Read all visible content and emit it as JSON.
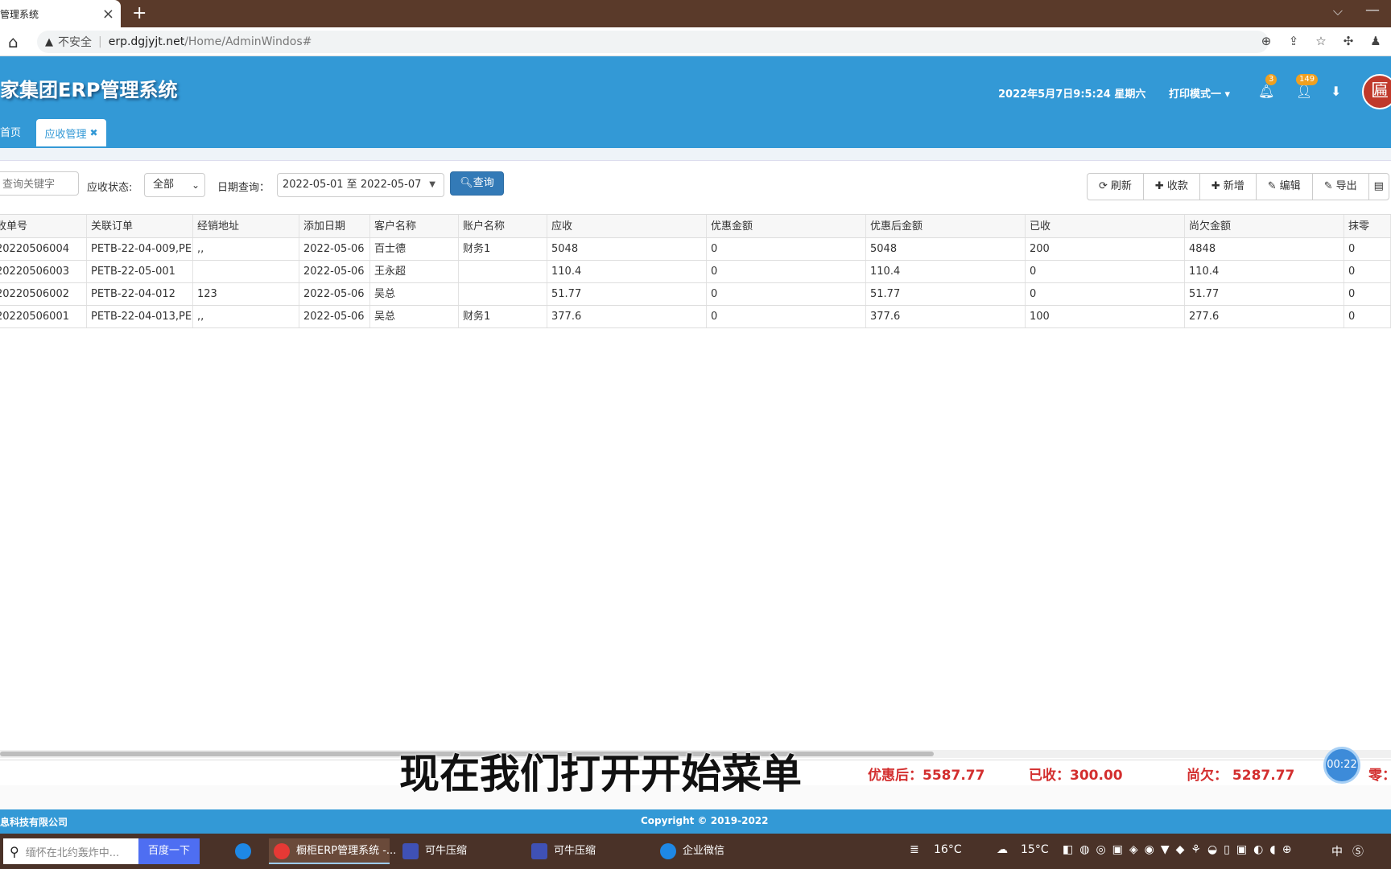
{
  "browser": {
    "tab_title": "管理系统",
    "insecure_label": "不安全",
    "url_host": "erp.dgjyjt.net",
    "url_path": "/Home/AdminWindos#"
  },
  "header": {
    "app_title": "家集团ERP管理系统",
    "datetime": "2022年5月7日9:5:24 星期六",
    "print_mode": "打印模式一",
    "notify_count": "3",
    "user_count": "149",
    "avatar_glyph": "匾"
  },
  "tabs": {
    "home": "首页",
    "active": "应收管理",
    "close": "✖"
  },
  "toolbar": {
    "search_placeholder": "查询关键字",
    "status_label": "应收状态:",
    "status_value": "全部",
    "date_label": "日期查询：",
    "date_range": "2022-05-01 至 2022-05-07",
    "query_label": "查询",
    "buttons": [
      {
        "icon": "refresh-icon",
        "label": "刷新"
      },
      {
        "icon": "plus-icon",
        "label": "收款"
      },
      {
        "icon": "plus-icon",
        "label": "新增"
      },
      {
        "icon": "edit-icon",
        "label": "编辑"
      },
      {
        "icon": "edit-icon",
        "label": "导出"
      }
    ]
  },
  "table": {
    "columns": [
      "收单号",
      "关联订单",
      "经销地址",
      "添加日期",
      "客户名称",
      "账户名称",
      "应收",
      "优惠金额",
      "优惠后金额",
      "已收",
      "尚欠金额",
      "抹零"
    ],
    "rows": [
      [
        "20220506004",
        "PETB-22-04-009,PE",
        ",,",
        "2022-05-06",
        "百士德",
        "财务1",
        "5048",
        "0",
        "5048",
        "200",
        "4848",
        "0"
      ],
      [
        "20220506003",
        "PETB-22-05-001",
        "",
        "2022-05-06",
        "王永超",
        "",
        "110.4",
        "0",
        "110.4",
        "0",
        "110.4",
        "0"
      ],
      [
        "20220506002",
        "PETB-22-04-012",
        "123",
        "2022-05-06",
        "吴总",
        "",
        "51.77",
        "0",
        "51.77",
        "0",
        "51.77",
        "0"
      ],
      [
        "20220506001",
        "PETB-22-04-013,PE",
        ",,",
        "2022-05-06",
        "吴总",
        "财务1",
        "377.6",
        "0",
        "377.6",
        "100",
        "277.6",
        "0"
      ]
    ]
  },
  "summary": {
    "after_discount": "优惠后：5587.77",
    "received": "已收：300.00",
    "owed": "尚欠：  5287.77",
    "wipe": "零："
  },
  "overlay": {
    "subtitle": "现在我们打开开始菜单",
    "timer": "00:22"
  },
  "footer": {
    "company": "息科技有限公司",
    "copyright": "Copyright © 2019-2022"
  },
  "taskbar": {
    "search_placeholder": "缅怀在北约轰炸中...",
    "baidu_label": "百度一下",
    "apps": [
      "橱柜ERP管理系统 -...",
      "可牛压缩",
      "可牛压缩",
      "企业微信"
    ],
    "temp1": "16°C",
    "temp2": "15°C",
    "ime": "中"
  },
  "colors": {
    "header_blue": "#3399d6",
    "query_blue": "#337ab7",
    "summary_red": "#d32f2f",
    "chrome_brown": "#5a3a2a"
  }
}
